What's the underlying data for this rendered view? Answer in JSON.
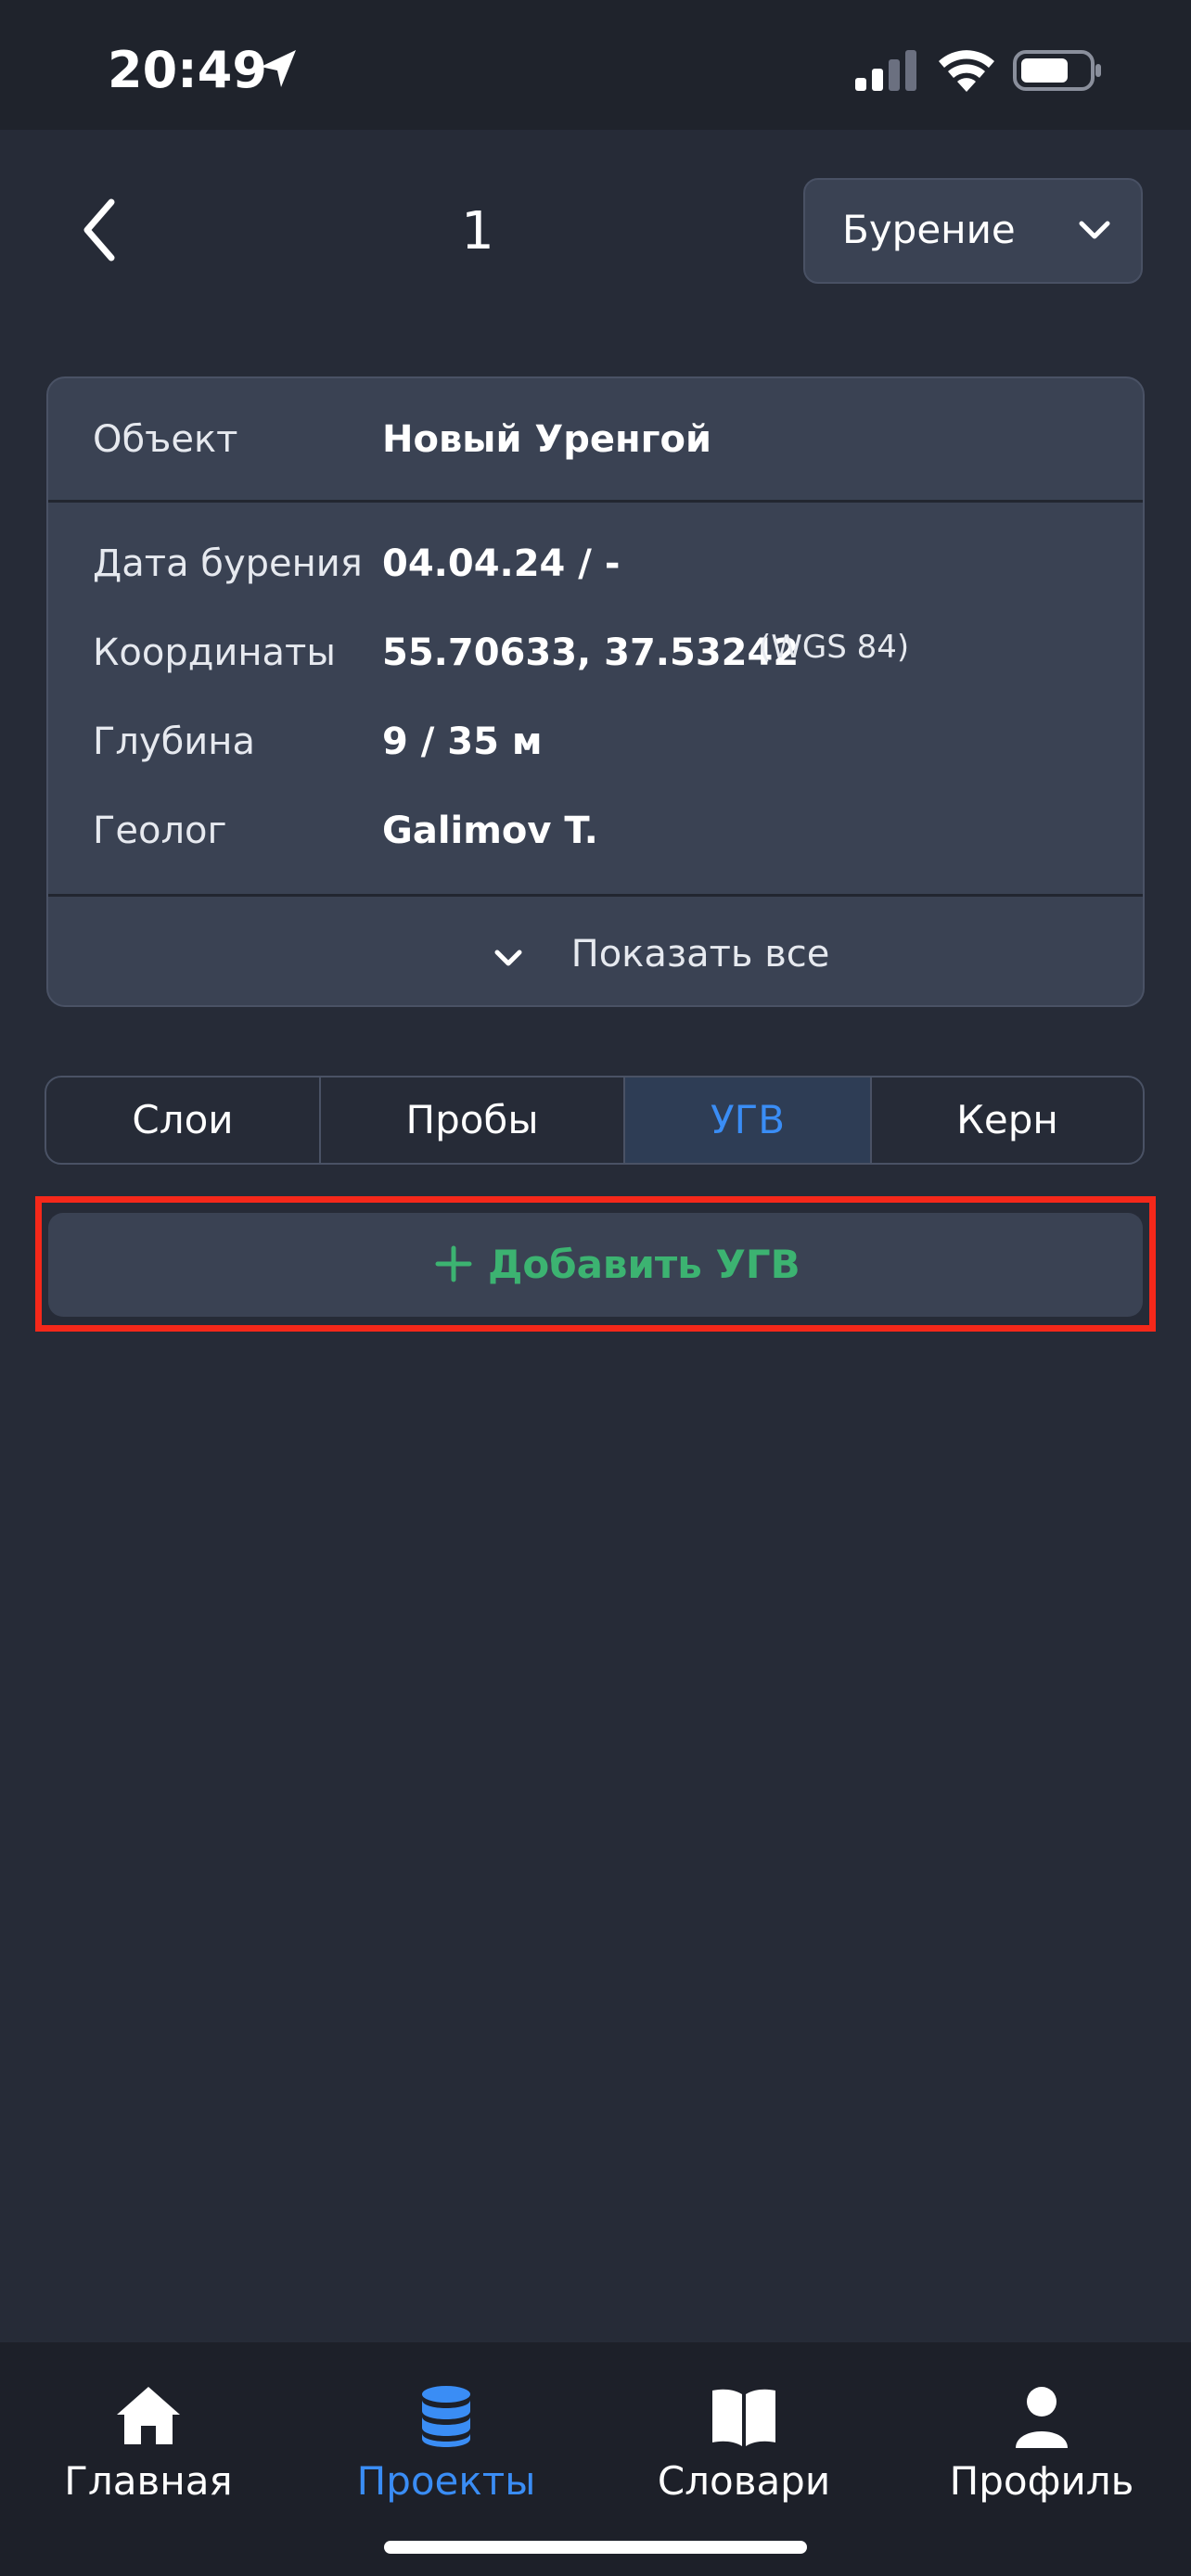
{
  "status_bar": {
    "time": "20:49"
  },
  "header": {
    "title": "1",
    "mode_select_value": "Бурение"
  },
  "info_card": {
    "object_label": "Объект",
    "object_value": "Новый Уренгой",
    "rows": [
      {
        "label": "Дата бурения",
        "value": "04.04.24 / -"
      },
      {
        "label": "Координаты",
        "value": "55.70633, 37.53242",
        "note": "(WGS 84)"
      },
      {
        "label": "Глубина",
        "value": "9 / 35 м"
      },
      {
        "label": "Геолог",
        "value": "Galimov T."
      }
    ],
    "show_all_label": "Показать все"
  },
  "tabs": [
    {
      "label": "Слои"
    },
    {
      "label": "Пробы"
    },
    {
      "label": "УГВ",
      "active": true
    },
    {
      "label": "Керн"
    }
  ],
  "add_button_label": "Добавить УГВ",
  "tab_bar": [
    {
      "label": "Главная",
      "icon": "home-icon"
    },
    {
      "label": "Проекты",
      "icon": "database-icon",
      "active": true
    },
    {
      "label": "Словари",
      "icon": "book-icon"
    },
    {
      "label": "Профиль",
      "icon": "user-icon"
    }
  ],
  "colors": {
    "background": "#262B37",
    "card": "#3A4253",
    "accent_blue": "#3A8DF5",
    "add_green": "#3CB371",
    "highlight_red": "#F5281A"
  }
}
